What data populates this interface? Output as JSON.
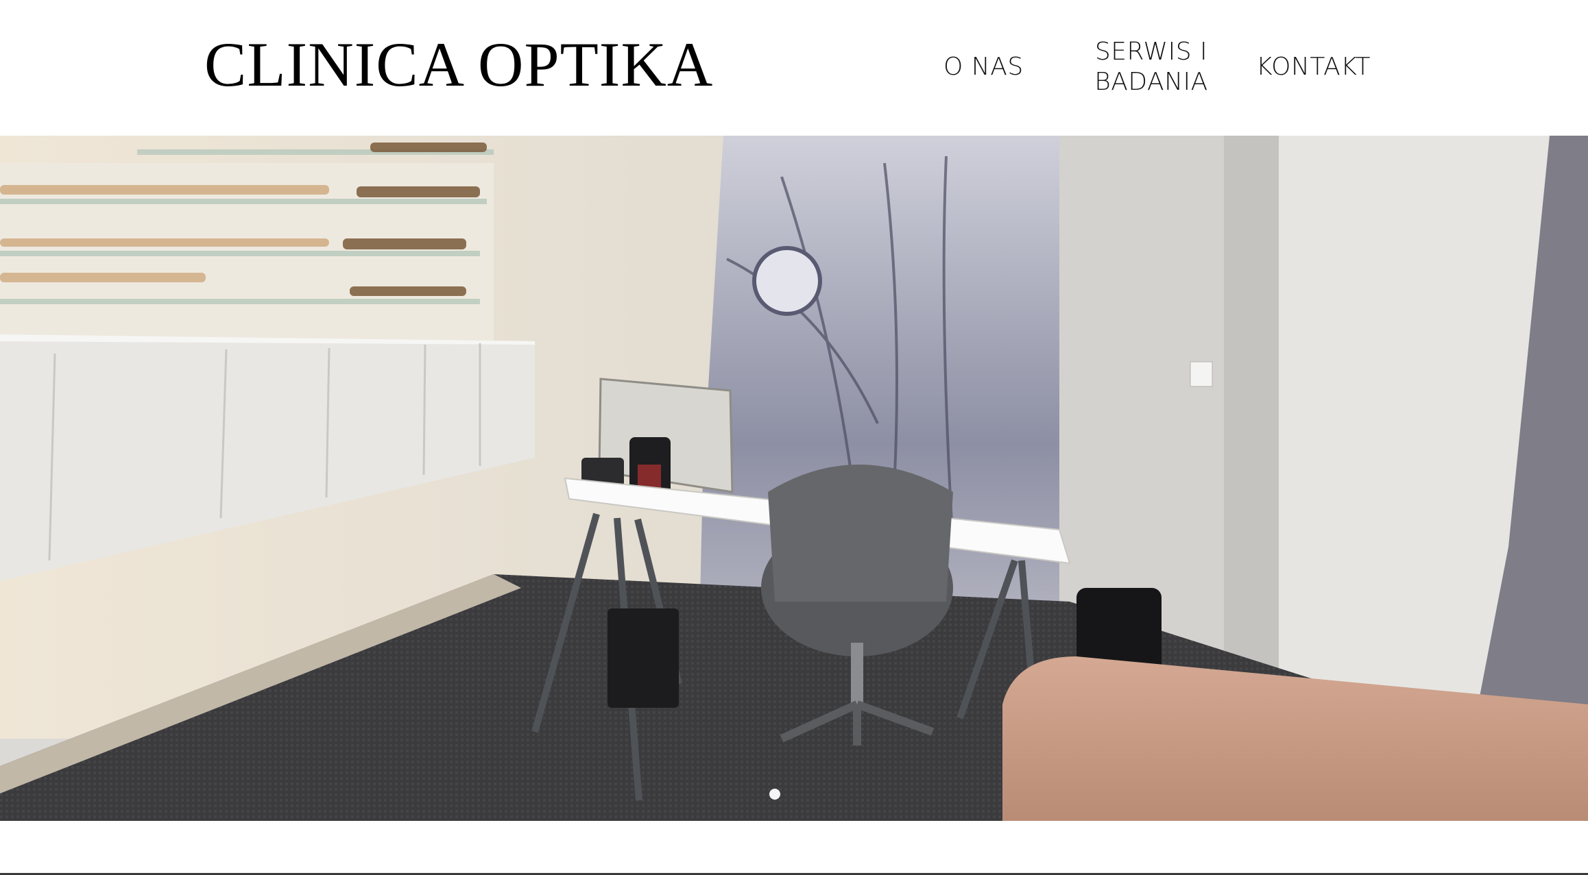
{
  "brand": {
    "name": "CLINICA OPTIKA"
  },
  "nav": {
    "items": [
      {
        "label": "O NAS"
      },
      {
        "label_line1": "SERWIS I",
        "label_line2": "BADANIA"
      },
      {
        "label": "KONTAKT"
      }
    ]
  },
  "hero": {
    "slide_count": 1,
    "active_slide": 1
  }
}
